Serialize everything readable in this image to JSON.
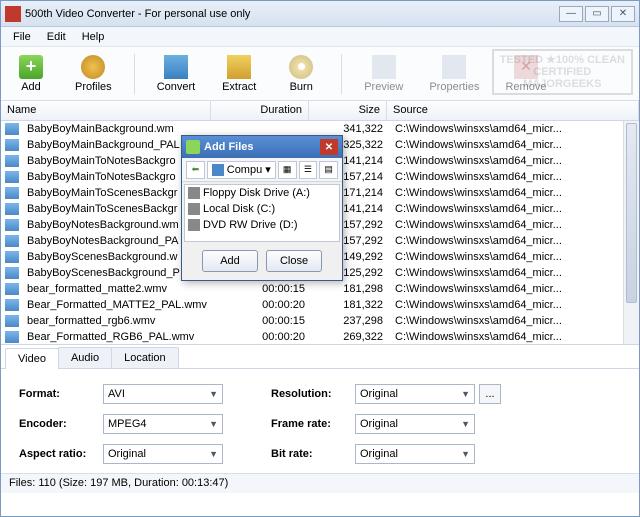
{
  "window": {
    "title": "500th Video Converter - For personal use only"
  },
  "menu": {
    "file": "File",
    "edit": "Edit",
    "help": "Help"
  },
  "toolbar": {
    "add": "Add",
    "profiles": "Profiles",
    "convert": "Convert",
    "extract": "Extract",
    "burn": "Burn",
    "preview": "Preview",
    "properties": "Properties",
    "remove": "Remove"
  },
  "watermark": {
    "l1": "TESTED ★100% CLEAN",
    "l2": "CERTIFIED",
    "l3": "MAJORGEEKS"
  },
  "columns": {
    "name": "Name",
    "duration": "Duration",
    "size": "Size",
    "source": "Source"
  },
  "rows": [
    {
      "name": "BabyBoyMainBackground.wm",
      "dur": "",
      "size": "341,322",
      "src": "C:\\Windows\\winsxs\\amd64_micr..."
    },
    {
      "name": "BabyBoyMainBackground_PAL",
      "dur": "",
      "size": "325,322",
      "src": "C:\\Windows\\winsxs\\amd64_micr..."
    },
    {
      "name": "BabyBoyMainToNotesBackgro",
      "dur": "",
      "size": "141,214",
      "src": "C:\\Windows\\winsxs\\amd64_micr..."
    },
    {
      "name": "BabyBoyMainToNotesBackgro",
      "dur": "",
      "size": "157,214",
      "src": "C:\\Windows\\winsxs\\amd64_micr..."
    },
    {
      "name": "BabyBoyMainToScenesBackgr",
      "dur": "",
      "size": "171,214",
      "src": "C:\\Windows\\winsxs\\amd64_micr..."
    },
    {
      "name": "BabyBoyMainToScenesBackgr",
      "dur": "",
      "size": "141,214",
      "src": "C:\\Windows\\winsxs\\amd64_micr..."
    },
    {
      "name": "BabyBoyNotesBackground.wm",
      "dur": "",
      "size": "157,292",
      "src": "C:\\Windows\\winsxs\\amd64_micr..."
    },
    {
      "name": "BabyBoyNotesBackground_PA",
      "dur": "",
      "size": "157,292",
      "src": "C:\\Windows\\winsxs\\amd64_micr..."
    },
    {
      "name": "BabyBoyScenesBackground.w",
      "dur": "",
      "size": "149,292",
      "src": "C:\\Windows\\winsxs\\amd64_micr..."
    },
    {
      "name": "BabyBoyScenesBackground_P",
      "dur": "",
      "size": "125,292",
      "src": "C:\\Windows\\winsxs\\amd64_micr..."
    },
    {
      "name": "bear_formatted_matte2.wmv",
      "dur": "00:00:15",
      "size": "181,298",
      "src": "C:\\Windows\\winsxs\\amd64_micr..."
    },
    {
      "name": "Bear_Formatted_MATTE2_PAL.wmv",
      "dur": "00:00:20",
      "size": "181,322",
      "src": "C:\\Windows\\winsxs\\amd64_micr..."
    },
    {
      "name": "bear_formatted_rgb6.wmv",
      "dur": "00:00:15",
      "size": "237,298",
      "src": "C:\\Windows\\winsxs\\amd64_micr..."
    },
    {
      "name": "Bear_Formatted_RGB6_PAL.wmv",
      "dur": "00:00:20",
      "size": "269,322",
      "src": "C:\\Windows\\winsxs\\amd64_micr..."
    }
  ],
  "tabs": {
    "video": "Video",
    "audio": "Audio",
    "location": "Location"
  },
  "form": {
    "format_l": "Format:",
    "format_v": "AVI",
    "encoder_l": "Encoder:",
    "encoder_v": "MPEG4",
    "aspect_l": "Aspect ratio:",
    "aspect_v": "Original",
    "resolution_l": "Resolution:",
    "resolution_v": "Original",
    "framerate_l": "Frame rate:",
    "framerate_v": "Original",
    "bitrate_l": "Bit rate:",
    "bitrate_v": "Original",
    "ext": "..."
  },
  "status": "Files: 110 (Size: 197 MB, Duration: 00:13:47)",
  "dialog": {
    "title": "Add Files",
    "location": "Compu",
    "items": [
      {
        "label": "Floppy Disk Drive (A:)"
      },
      {
        "label": "Local Disk (C:)"
      },
      {
        "label": "DVD RW Drive (D:)"
      }
    ],
    "add": "Add",
    "close": "Close"
  }
}
